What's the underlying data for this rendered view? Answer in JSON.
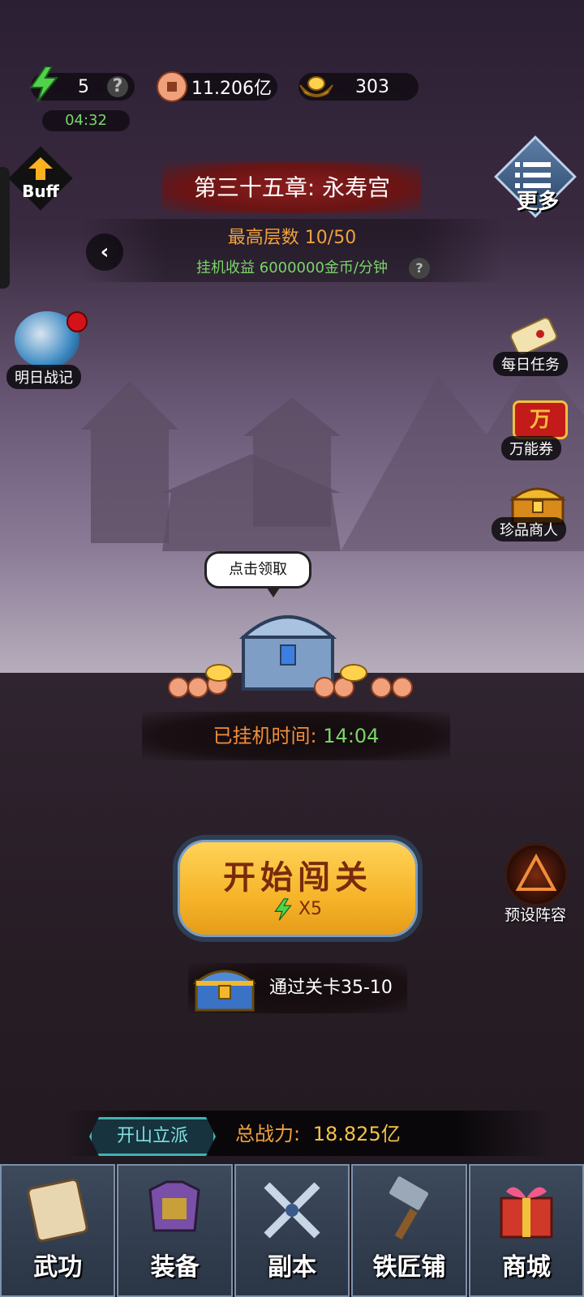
{
  "resources": {
    "energy": "5",
    "energy_timer": "04:32",
    "coins": "11.206亿",
    "gold": "303"
  },
  "buff_label": "Buff",
  "more_label": "更多",
  "chapter": {
    "title": "第三十五章: 永寿宫",
    "highest_floor": "最高层数 10/50",
    "idle_income": "挂机收益 6000000金币/分钟"
  },
  "left_events": [
    {
      "label": "明日战记"
    }
  ],
  "right_events": [
    {
      "label": "每日任务"
    },
    {
      "label": "万能券",
      "icon_text": "万"
    },
    {
      "label": "珍品商人"
    }
  ],
  "idle": {
    "bubble": "点击领取",
    "label": "已挂机时间:",
    "time": "14:04"
  },
  "start": {
    "title": "开始闯关",
    "cost": "X5"
  },
  "preset_lineup": "预设阵容",
  "reward": {
    "text": "通过关卡35-10"
  },
  "power": {
    "sect_button": "开山立派",
    "label": "总战力:",
    "value": "18.825亿"
  },
  "nav": [
    {
      "label": "武功",
      "icon": "scroll-icon"
    },
    {
      "label": "装备",
      "icon": "armor-icon"
    },
    {
      "label": "副本",
      "icon": "crossed-swords-icon"
    },
    {
      "label": "铁匠铺",
      "icon": "hammer-icon"
    },
    {
      "label": "商城",
      "icon": "gift-box-icon"
    }
  ],
  "colors": {
    "green": "#7ad56a",
    "orange": "#f0a23c",
    "nav_border": "#7d91aa",
    "start_gold": "#f6b429"
  }
}
